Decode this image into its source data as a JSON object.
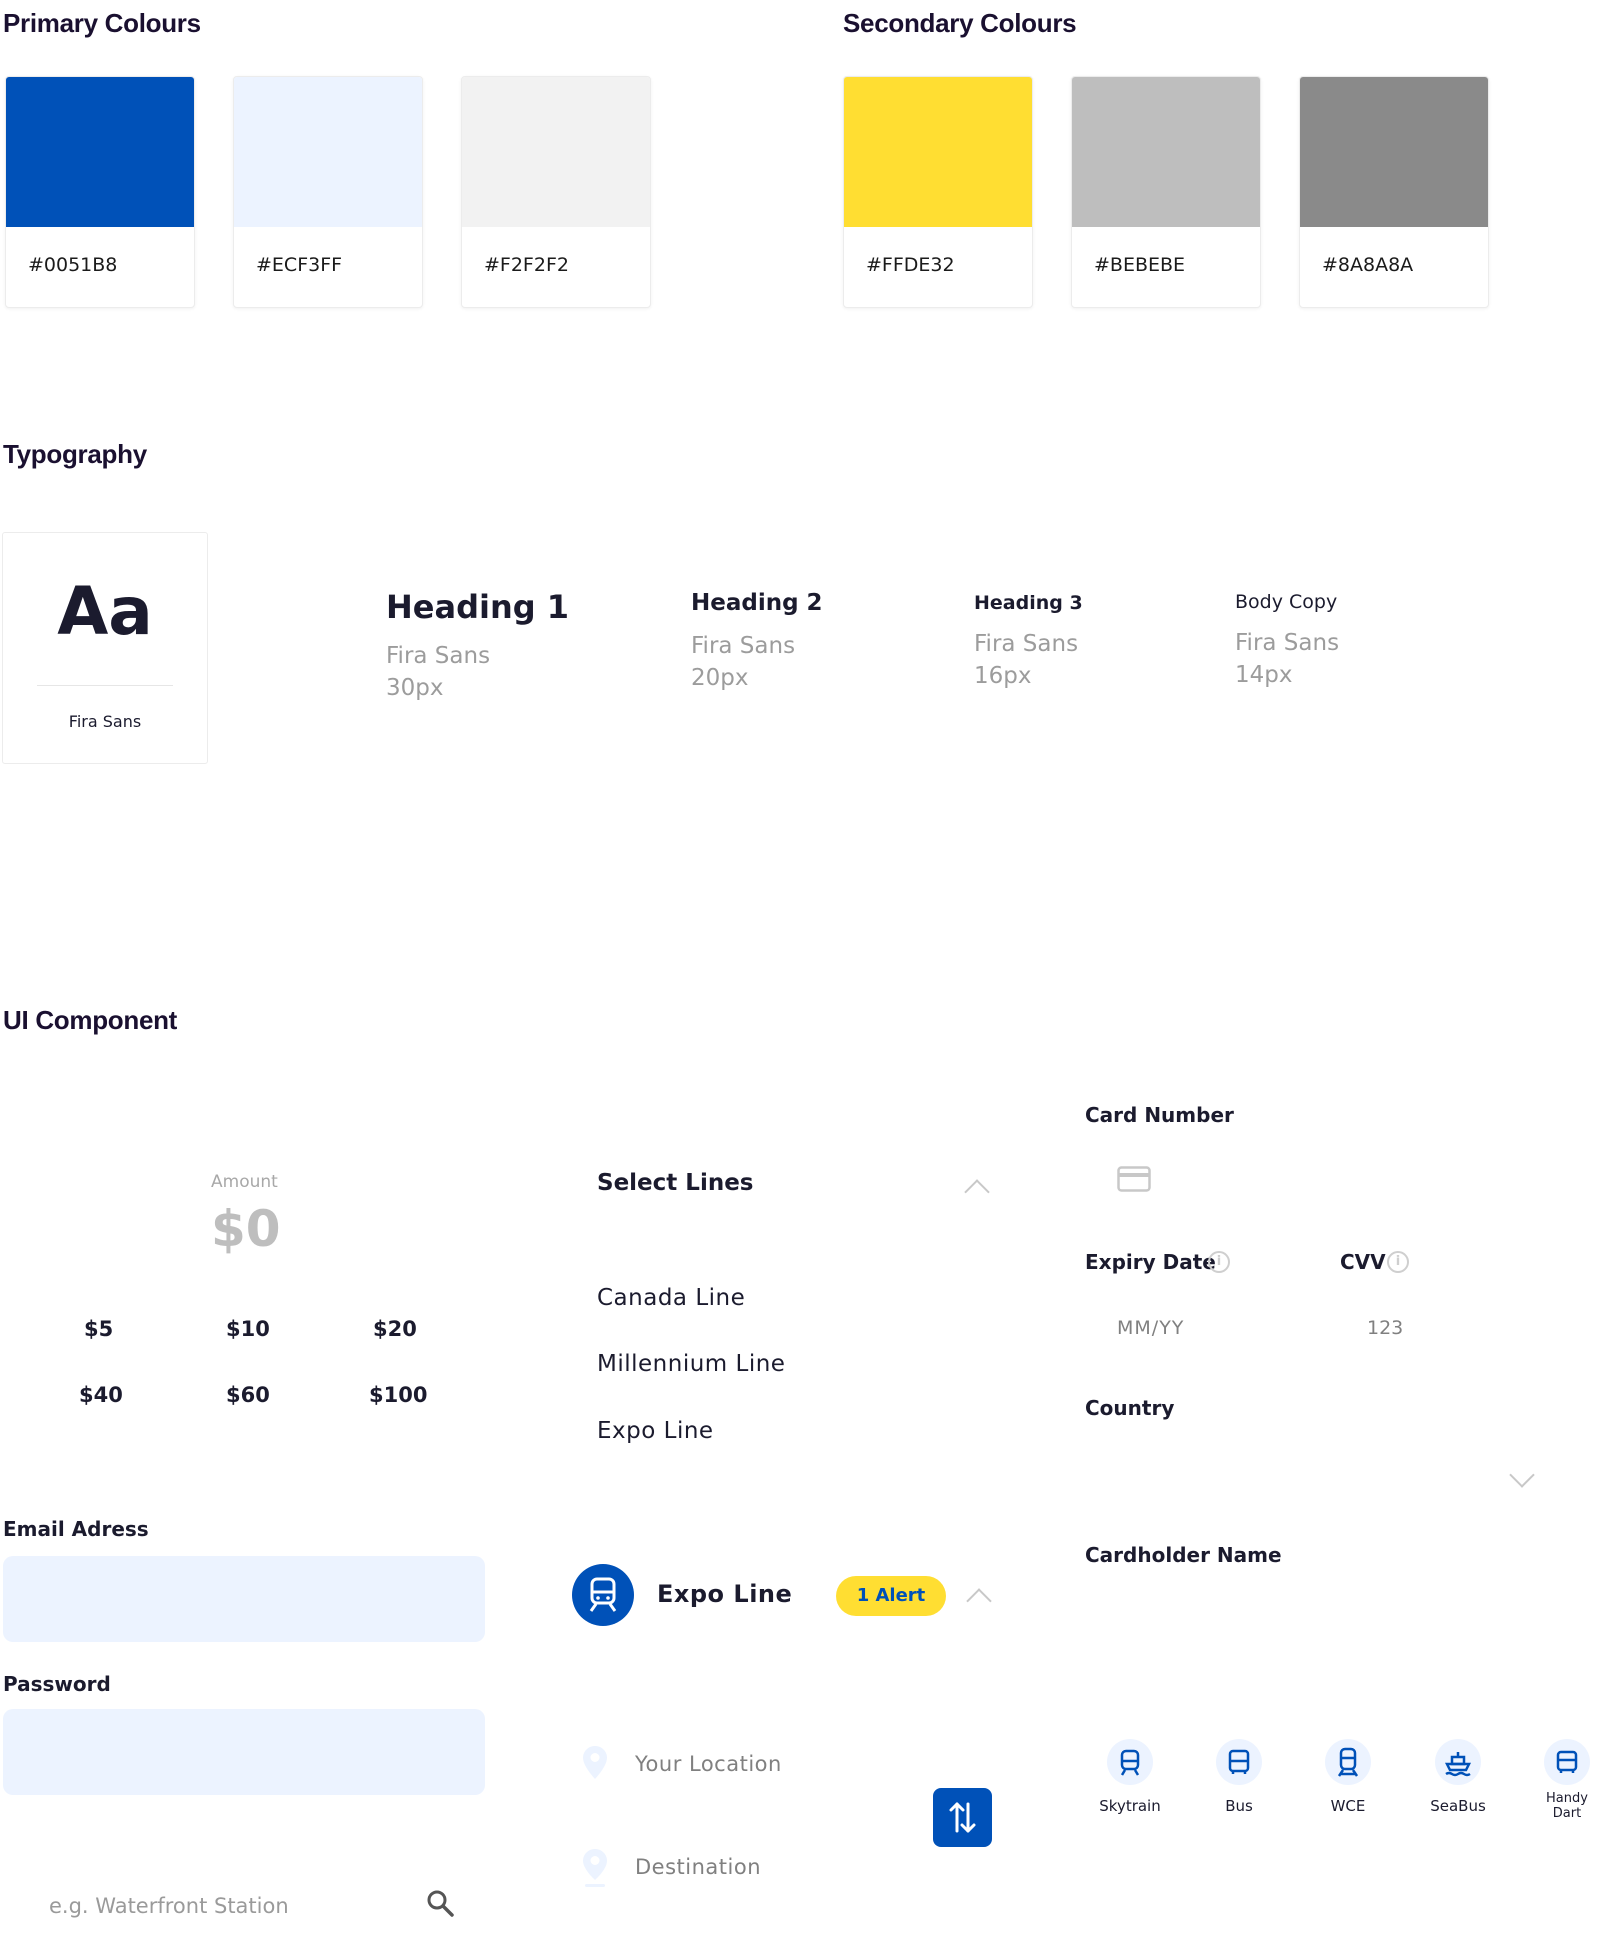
{
  "colors": {
    "primary_title": "Primary Colours",
    "secondary_title": "Secondary Colours",
    "primary": [
      {
        "hex_label": "#0051B8",
        "value": "#0051B8"
      },
      {
        "hex_label": "#ECF3FF",
        "value": "#ECF3FF"
      },
      {
        "hex_label": "#F2F2F2",
        "value": "#F2F2F2"
      }
    ],
    "secondary": [
      {
        "hex_label": "#FFDE32",
        "value": "#FFDE32"
      },
      {
        "hex_label": "#BEBEBE",
        "value": "#BEBEBE"
      },
      {
        "hex_label": "#8A8A8A",
        "value": "#8A8A8A"
      }
    ]
  },
  "typography": {
    "title": "Typography",
    "sample": "Aa",
    "font_name": "Fira Sans",
    "specs": [
      {
        "label": "Heading 1",
        "font": "Fira Sans",
        "size": "30px"
      },
      {
        "label": "Heading 2",
        "font": "Fira Sans",
        "size": "20px"
      },
      {
        "label": "Heading 3",
        "font": "Fira Sans",
        "size": "16px"
      },
      {
        "label": "Body Copy",
        "font": "Fira Sans",
        "size": "14px"
      }
    ]
  },
  "ui": {
    "title": "UI Component",
    "amount": {
      "label": "Amount",
      "value": "$0",
      "options": [
        "$5",
        "$10",
        "$20",
        "$40",
        "$60",
        "$100"
      ]
    },
    "email_label": "Email Adress",
    "password_label": "Password",
    "search_placeholder": "e.g. Waterfront Station",
    "select_lines": {
      "title": "Select Lines",
      "items": [
        "Canada Line",
        "Millennium Line",
        "Expo Line"
      ]
    },
    "alert_row": {
      "line": "Expo Line",
      "badge": "1 Alert"
    },
    "route": {
      "from": "Your Location",
      "to": "Destination"
    },
    "payment": {
      "card_number_label": "Card Number",
      "expiry_label": "Expiry Date",
      "expiry_placeholder": "MM/YY",
      "cvv_label": "CVV",
      "cvv_placeholder": "123",
      "country_label": "Country",
      "cardholder_label": "Cardholder Name"
    },
    "modes": [
      {
        "label": "Skytrain",
        "icon": "train-icon"
      },
      {
        "label": "Bus",
        "icon": "bus-icon"
      },
      {
        "label": "WCE",
        "icon": "commuter-train-icon"
      },
      {
        "label": "SeaBus",
        "icon": "ferry-icon"
      },
      {
        "label": "Handy Dart",
        "icon": "van-icon"
      }
    ],
    "accent": "#0051B8",
    "badge_color": "#FFDE32"
  }
}
